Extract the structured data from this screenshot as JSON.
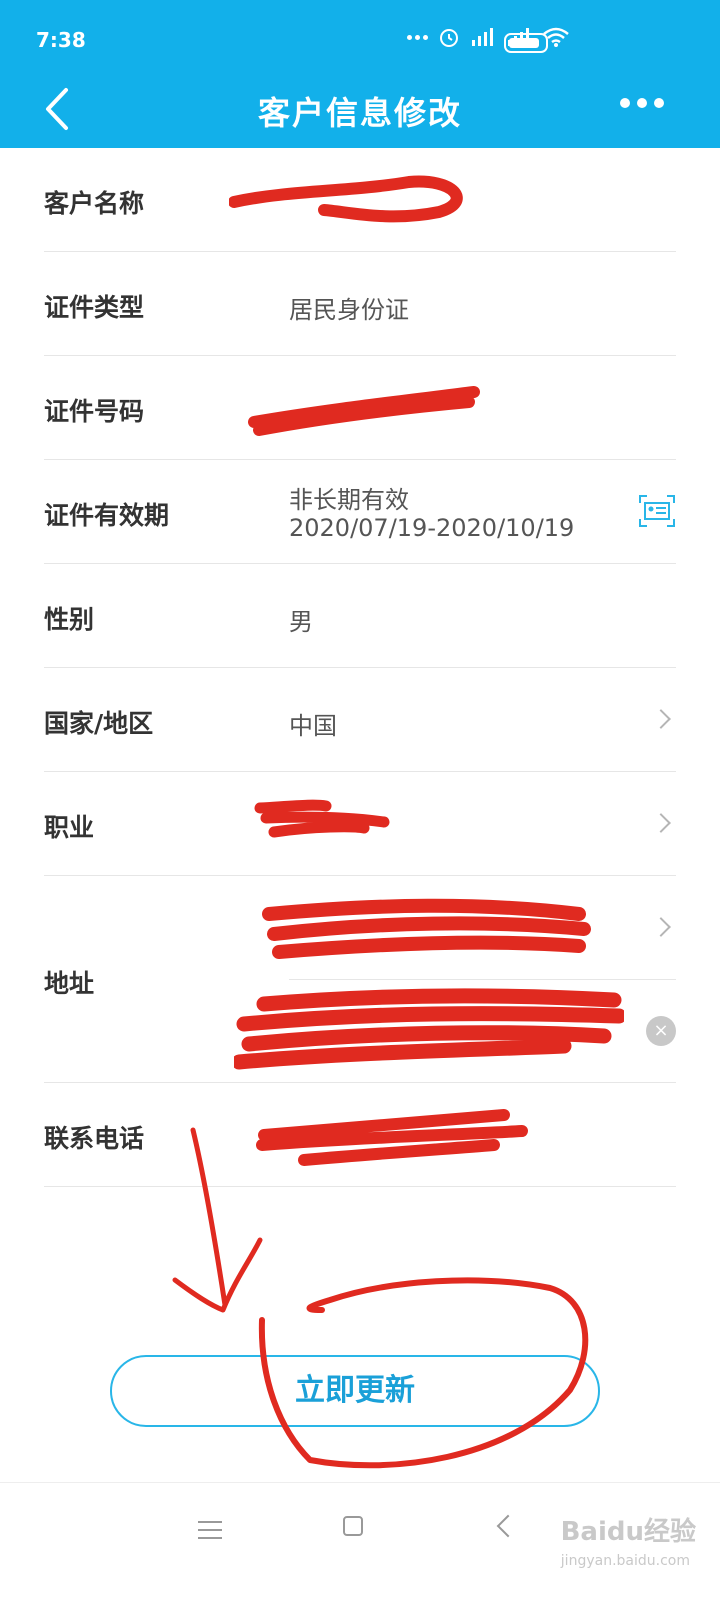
{
  "status_bar": {
    "time": "7:38"
  },
  "nav": {
    "title": "客户信息修改"
  },
  "form": {
    "customer_name_label": "客户名称",
    "id_type_label": "证件类型",
    "id_type_value": "居民身份证",
    "id_number_label": "证件号码",
    "id_validity_label": "证件有效期",
    "id_validity_type": "非长期有效",
    "id_validity_range": "2020/07/19-2020/10/19",
    "gender_label": "性别",
    "gender_value": "男",
    "country_label": "国家/地区",
    "country_value": "中国",
    "occupation_label": "职业",
    "address_label": "地址",
    "phone_label": "联系电话",
    "clear_symbol": "×"
  },
  "actions": {
    "submit_label": "立即更新"
  },
  "watermark": {
    "brand": "Baidu经验",
    "domain": "jingyan.baidu.com"
  },
  "colors": {
    "primary": "#12b0ea",
    "button_text": "#1aa0d8",
    "annotation": "#e02a20"
  }
}
